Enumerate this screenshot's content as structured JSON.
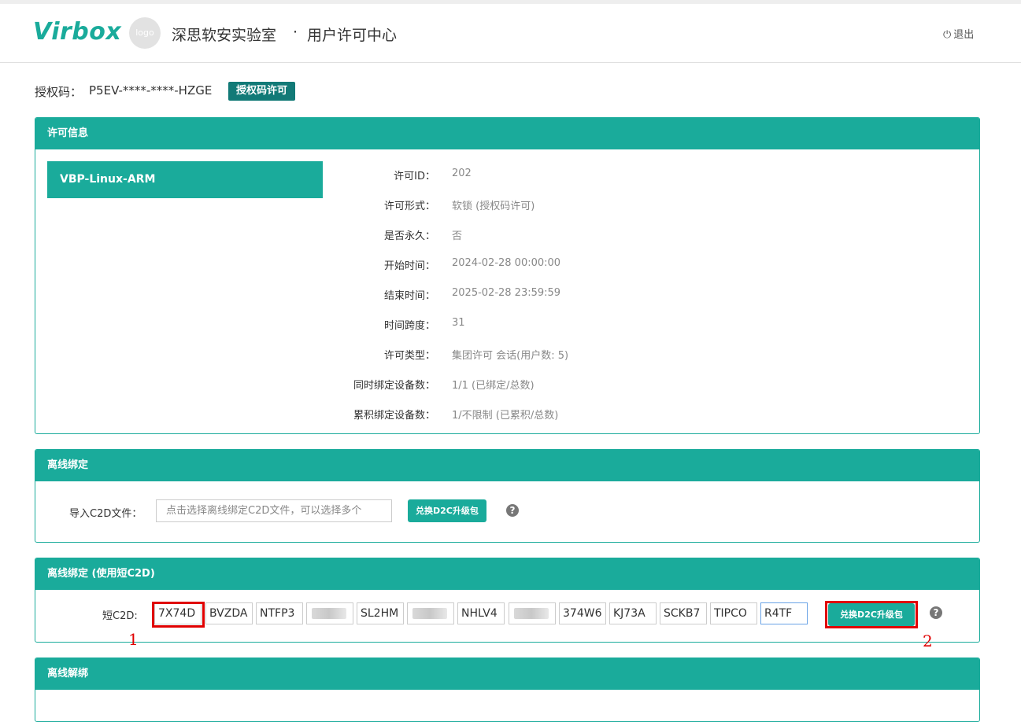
{
  "header": {
    "brand": "Virbox",
    "logo_text": "logo",
    "org": "深思软安实验室",
    "separator": "·",
    "center": "用户许可中心",
    "logout": "退出"
  },
  "authcode": {
    "label": "授权码：",
    "value": "P5EV-****-****-HZGE",
    "badge": "授权码许可"
  },
  "license_panel": {
    "title": "许可信息",
    "item": "VBP-Linux-ARM",
    "fields": [
      {
        "key": "许可ID：",
        "value": "202"
      },
      {
        "key": "许可形式：",
        "value": "软锁 (授权码许可)"
      },
      {
        "key": "是否永久：",
        "value": "否"
      },
      {
        "key": "开始时间：",
        "value": "2024-02-28 00:00:00"
      },
      {
        "key": "结束时间：",
        "value": "2025-02-28 23:59:59"
      },
      {
        "key": "时间跨度：",
        "value": "31"
      },
      {
        "key": "许可类型：",
        "value": "集团许可 会话(用户数: 5)"
      },
      {
        "key": "同时绑定设备数：",
        "value": "1/1 (已绑定/总数)"
      },
      {
        "key": "累积绑定设备数：",
        "value": "1/不限制 (已累积/总数)"
      }
    ]
  },
  "offline_bind": {
    "title": "离线绑定",
    "import_label": "导入C2D文件：",
    "input_placeholder": "点击选择离线绑定C2D文件，可以选择多个",
    "button": "兑换D2C升级包",
    "help_icon": "question-circle-icon"
  },
  "offline_bind_short": {
    "title": "离线绑定 (使用短C2D)",
    "label": "短C2D:",
    "segments": [
      "7X74D",
      "BVZDA",
      "NTFP3",
      "",
      "SL2HM",
      "",
      "NHLV4",
      "",
      "374W6",
      "KJ73A",
      "SCKB7",
      "TIPCO",
      "R4TF"
    ],
    "button": "兑换D2C升级包",
    "help_icon": "question-circle-icon",
    "marker_1": "1",
    "marker_2": "2"
  },
  "offline_unbind": {
    "title": "离线解绑"
  },
  "colors": {
    "accent": "#1aab9b",
    "badge": "#127a77",
    "highlight": "#e00000"
  }
}
